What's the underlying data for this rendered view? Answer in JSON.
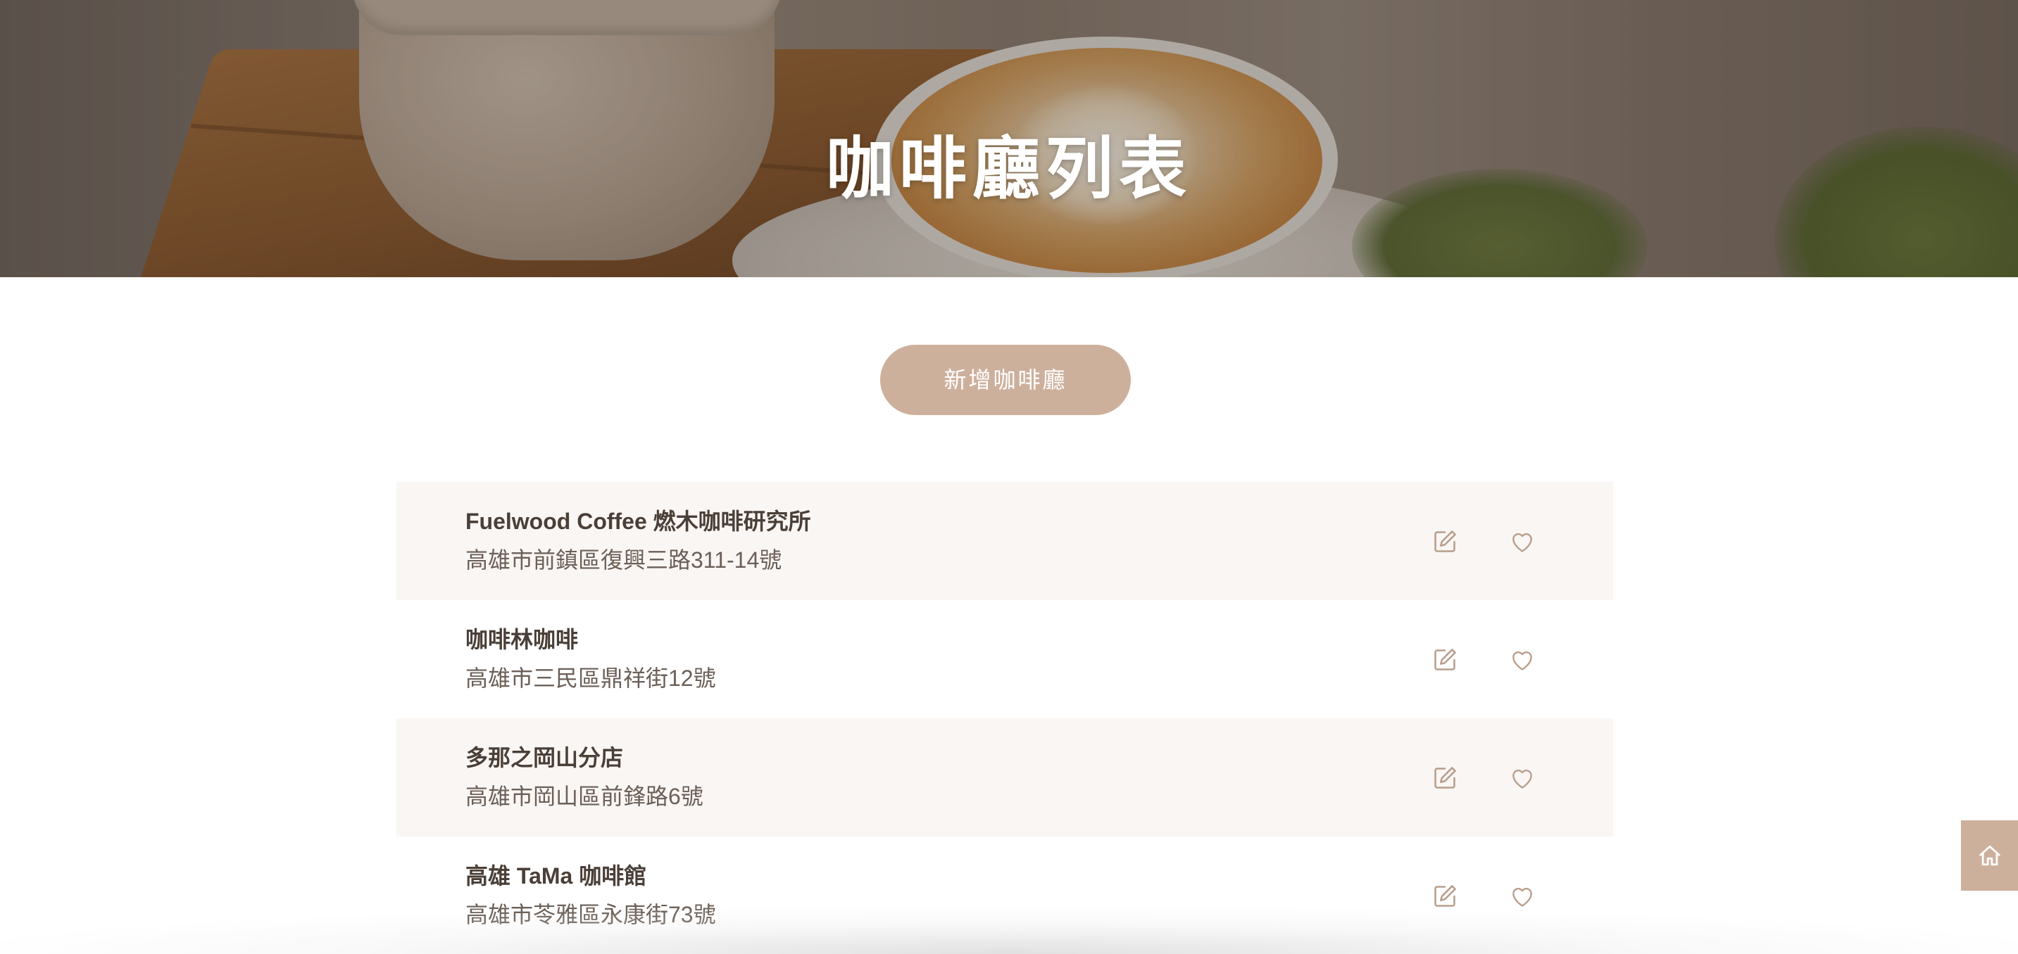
{
  "header": {
    "title": "咖啡廳列表"
  },
  "actions": {
    "add_label": "新增咖啡廳"
  },
  "cafes": [
    {
      "name": "Fuelwood Coffee 燃木咖啡研究所",
      "address": "高雄市前鎮區復興三路311-14號"
    },
    {
      "name": "咖啡林咖啡",
      "address": "高雄市三民區鼎祥街12號"
    },
    {
      "name": "多那之岡山分店",
      "address": "高雄市岡山區前鋒路6號"
    },
    {
      "name": "高雄 TaMa 咖啡館",
      "address": "高雄市苓雅區永康街73號"
    }
  ],
  "icons": {
    "edit": "edit-icon",
    "like": "heart-icon",
    "home": "home-icon"
  },
  "colors": {
    "accent": "#cdb09c",
    "row_shade": "#faf6f3",
    "text_primary": "#4a3f37",
    "text_secondary": "#6b5f57",
    "icon": "#b89e8c"
  }
}
